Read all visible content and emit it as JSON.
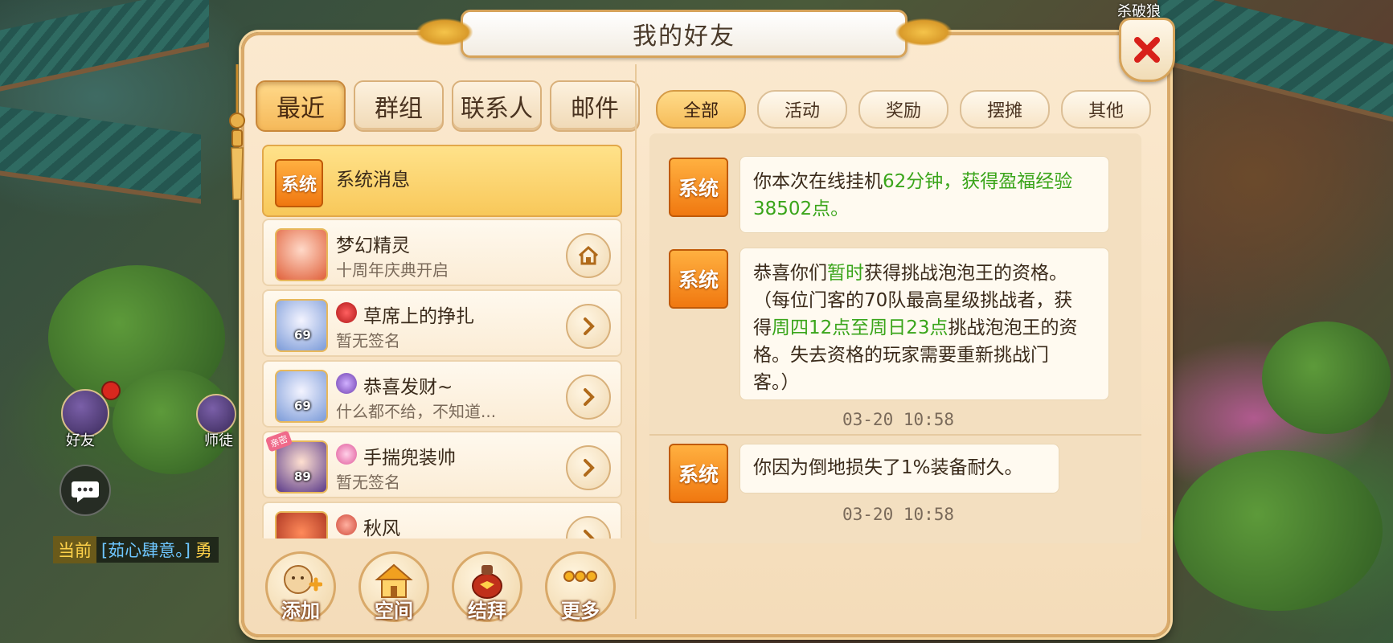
{
  "dialog": {
    "title": "我的好友"
  },
  "world": {
    "top_name": "杀破狼",
    "hud": {
      "friends_label": "好友",
      "mentor_label": "师徒"
    },
    "chat": {
      "tag": "当前",
      "name": "[茹心肆意。]",
      "extra": "勇"
    }
  },
  "left_tabs": [
    {
      "label": "最近",
      "active": true
    },
    {
      "label": "群组",
      "active": false
    },
    {
      "label": "联系人",
      "active": false
    },
    {
      "label": "邮件",
      "active": false
    }
  ],
  "contacts": [
    {
      "badge": "系统",
      "name": "系统消息",
      "sub": "",
      "active": true
    },
    {
      "name": "梦幻精灵",
      "sub": "十周年庆典开启",
      "icon": "home-icon"
    },
    {
      "name": "草席上的挣扎",
      "sub": "暂无签名",
      "level": "69",
      "icon": "chevron-right-icon"
    },
    {
      "name": "恭喜发财~",
      "sub": "什么都不给，不知道...",
      "level": "69",
      "icon": "chevron-right-icon"
    },
    {
      "name": "手揣兜装帅",
      "sub": "暂无签名",
      "level": "89",
      "icon": "chevron-right-icon",
      "tag": "亲密"
    },
    {
      "name": "秋风",
      "sub": "",
      "icon": "chevron-right-icon"
    }
  ],
  "bottom_buttons": [
    {
      "label": "添加",
      "icon": "add-friend-icon"
    },
    {
      "label": "空间",
      "icon": "house-icon"
    },
    {
      "label": "结拜",
      "icon": "gourd-icon"
    },
    {
      "label": "更多",
      "icon": "more-icon"
    }
  ],
  "right_tabs": [
    {
      "label": "全部",
      "active": true
    },
    {
      "label": "活动",
      "active": false
    },
    {
      "label": "奖励",
      "active": false
    },
    {
      "label": "摆摊",
      "active": false
    },
    {
      "label": "其他",
      "active": false
    }
  ],
  "messages": {
    "sender": "系统",
    "m1": {
      "a": "你本次在线挂机",
      "b": "62分钟，获得盈福经验",
      "c": "38502点。"
    },
    "m2": {
      "line1a": "恭喜你们",
      "line1b": "暂时",
      "line1c": "获得挑战泡泡王的资格。",
      "line2": "（每位门客的70队最高星级挑战者，获",
      "line3a": "得",
      "line3b": "周四12点至周日23点",
      "line3c": "挑战泡泡王的资",
      "line4": "格。失去资格的玩家需要重新挑战门",
      "line5": "客。）",
      "time": "03-20  10:58"
    },
    "m3": {
      "text": "你因为倒地损失了1%装备耐久。",
      "time": "03-20  10:58"
    }
  },
  "colors": {
    "highlight": "#3aa51a",
    "accent": "#f6bd5a",
    "system_badge": "#f07810"
  }
}
